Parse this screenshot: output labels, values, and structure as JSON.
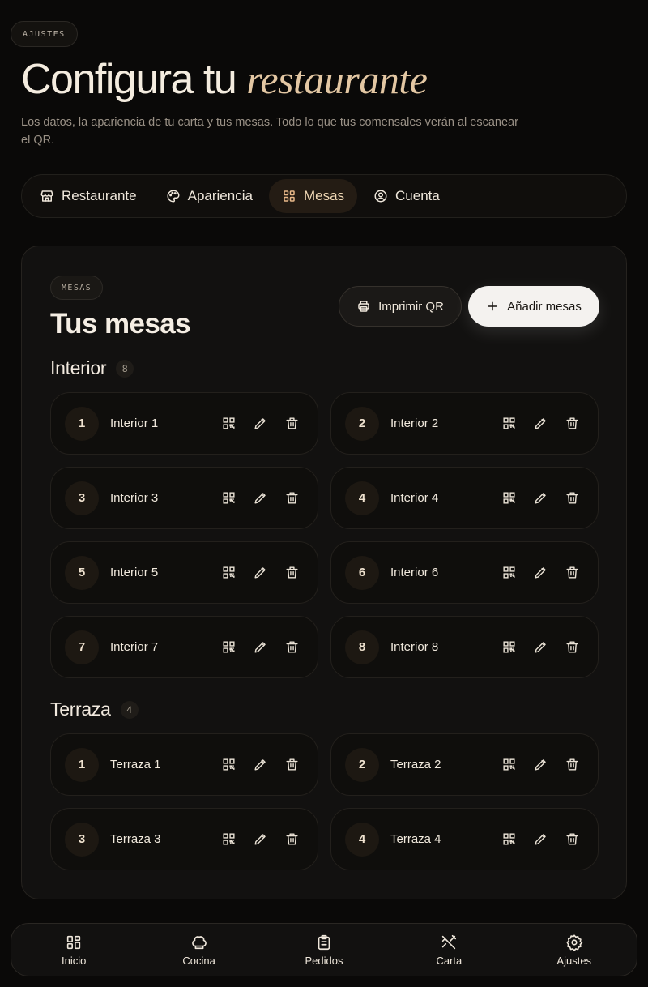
{
  "header": {
    "eyebrow": "AJUSTES",
    "title_main": "Configura tu",
    "title_accent": "restaurante",
    "subtitle": "Los datos, la apariencia de tu carta y tus mesas. Todo lo que tus comensales verán al escanear el QR."
  },
  "tabs": [
    {
      "label": "Restaurante",
      "icon": "store-icon",
      "active": false
    },
    {
      "label": "Apariencia",
      "icon": "palette-icon",
      "active": false
    },
    {
      "label": "Mesas",
      "icon": "grid-icon",
      "active": true
    },
    {
      "label": "Cuenta",
      "icon": "user-circle-icon",
      "active": false
    }
  ],
  "panel": {
    "eyebrow": "MESAS",
    "title": "Tus mesas",
    "print_label": "Imprimir QR",
    "add_label": "Añadir mesas"
  },
  "sections": [
    {
      "name": "Interior",
      "count": "8",
      "tables": [
        {
          "number": "1",
          "name": "Interior 1"
        },
        {
          "number": "2",
          "name": "Interior 2"
        },
        {
          "number": "3",
          "name": "Interior 3"
        },
        {
          "number": "4",
          "name": "Interior 4"
        },
        {
          "number": "5",
          "name": "Interior 5"
        },
        {
          "number": "6",
          "name": "Interior 6"
        },
        {
          "number": "7",
          "name": "Interior 7"
        },
        {
          "number": "8",
          "name": "Interior 8"
        }
      ]
    },
    {
      "name": "Terraza",
      "count": "4",
      "tables": [
        {
          "number": "1",
          "name": "Terraza 1"
        },
        {
          "number": "2",
          "name": "Terraza 2"
        },
        {
          "number": "3",
          "name": "Terraza 3"
        },
        {
          "number": "4",
          "name": "Terraza 4"
        }
      ]
    }
  ],
  "bottom_nav": [
    {
      "label": "Inicio",
      "icon": "dashboard-icon"
    },
    {
      "label": "Cocina",
      "icon": "chef-hat-icon"
    },
    {
      "label": "Pedidos",
      "icon": "clipboard-list-icon"
    },
    {
      "label": "Carta",
      "icon": "utensils-icon"
    },
    {
      "label": "Ajustes",
      "icon": "gear-icon"
    }
  ],
  "colors": {
    "background": "#0a0908",
    "accent": "#e3c7a3",
    "active_tab_bg": "#241c14"
  }
}
